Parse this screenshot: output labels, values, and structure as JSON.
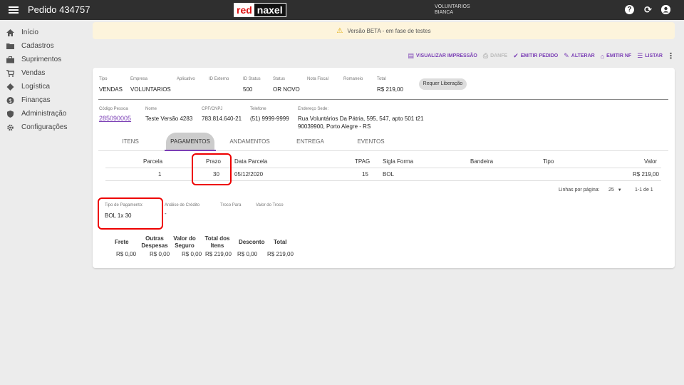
{
  "topbar": {
    "title": "Pedido 434757",
    "logo_left": "red",
    "logo_right": "naxel",
    "user_line1": "VOLUNTARIOS",
    "user_line2": "BIANCA",
    "help_icon": "?",
    "refresh_icon": "⟳",
    "account_icon": "●"
  },
  "sidebar": {
    "items": [
      {
        "label": "Início",
        "icon": "home-icon"
      },
      {
        "label": "Cadastros",
        "icon": "folder-icon"
      },
      {
        "label": "Suprimentos",
        "icon": "briefcase-icon"
      },
      {
        "label": "Vendas",
        "icon": "cart-icon"
      },
      {
        "label": "Logística",
        "icon": "diamond-icon"
      },
      {
        "label": "Finanças",
        "icon": "dollar-icon"
      },
      {
        "label": "Administração",
        "icon": "shield-icon"
      },
      {
        "label": "Configurações",
        "icon": "gear-icon"
      }
    ]
  },
  "banner": {
    "text": "Versão BETA - em fase de testes"
  },
  "toolbar": {
    "visualizar": "VISUALIZAR IMPRESSÃO",
    "danfe": "DANFE",
    "emitir_pedido": "EMITIR PEDIDO",
    "alterar": "ALTERAR",
    "emitir_nf": "EMITIR NF",
    "listar": "LISTAR"
  },
  "order": {
    "tipo_label": "Tipo",
    "tipo": "VENDAS",
    "empresa_label": "Empresa",
    "empresa": "VOLUNTARIOS",
    "aplicativo_label": "Aplicativo",
    "id_externo_label": "ID Externo",
    "id_status_label": "ID Status",
    "id_status": "500",
    "status_label": "Status",
    "status": "OR NOVO",
    "nota_fiscal_label": "Nota Fiscal",
    "romaneio_label": "Romaneio",
    "total_label": "Total",
    "total": "R$ 219,00",
    "requer_liberacao": "Requer Liberação"
  },
  "customer": {
    "codigo_label": "Código Pessoa",
    "codigo": "285090005",
    "nome_label": "Nome",
    "nome": "Teste Versão 4283",
    "cpf_label": "CPF/CNPJ",
    "cpf": "783.814.640-21",
    "telefone_label": "Telefone",
    "telefone": "(51) 9999-9999",
    "endereco_label": "Endereço Sede:",
    "endereco_1": "Rua Voluntários Da Pátria, 595, 547, apto 501 t21",
    "endereco_2": "90039900, Porto Alegre - RS"
  },
  "tabs": [
    "ITENS",
    "PAGAMENTOS",
    "ANDAMENTOS",
    "ENTREGA",
    "EVENTOS"
  ],
  "payments": {
    "headers": {
      "parcela": "Parcela",
      "prazo": "Prazo",
      "data": "Data Parcela",
      "tpag": "TPAG",
      "sigla": "Sigla Forma",
      "bandeira": "Bandeira",
      "tipo": "Tipo",
      "valor": "Valor"
    },
    "rows": [
      {
        "parcela": "1",
        "prazo": "30",
        "data": "05/12/2020",
        "tpag": "15",
        "sigla": "BOL",
        "bandeira": "",
        "tipo": "",
        "valor": "R$ 219,00"
      }
    ],
    "rows_per_page_label": "Linhas por página:",
    "rows_per_page": "25",
    "range": "1-1 de 1"
  },
  "payment_info": {
    "tipo_label": "Tipo de Pagamento:",
    "tipo": "BOL 1x 30",
    "analise_label": "Análise de Crédito",
    "analise": "-",
    "troco_para_label": "Troco Para",
    "valor_troco_label": "Valor do Troco"
  },
  "totals": {
    "frete_label": "Frete",
    "frete": "R$ 0,00",
    "outras_label_1": "Outras",
    "outras_label_2": "Despesas",
    "outras": "R$ 0,00",
    "seguro_label_1": "Valor do",
    "seguro_label_2": "Seguro",
    "seguro": "R$ 0,00",
    "itens_label_1": "Total dos",
    "itens_label_2": "Itens",
    "itens": "R$ 219,00",
    "desconto_label": "Desconto",
    "desconto": "R$ 0,00",
    "total_label": "Total",
    "total": "R$ 219,00"
  },
  "colors": {
    "accent": "#7b3fb5",
    "topbar": "#2f2f2f",
    "highlight": "#e00000"
  }
}
